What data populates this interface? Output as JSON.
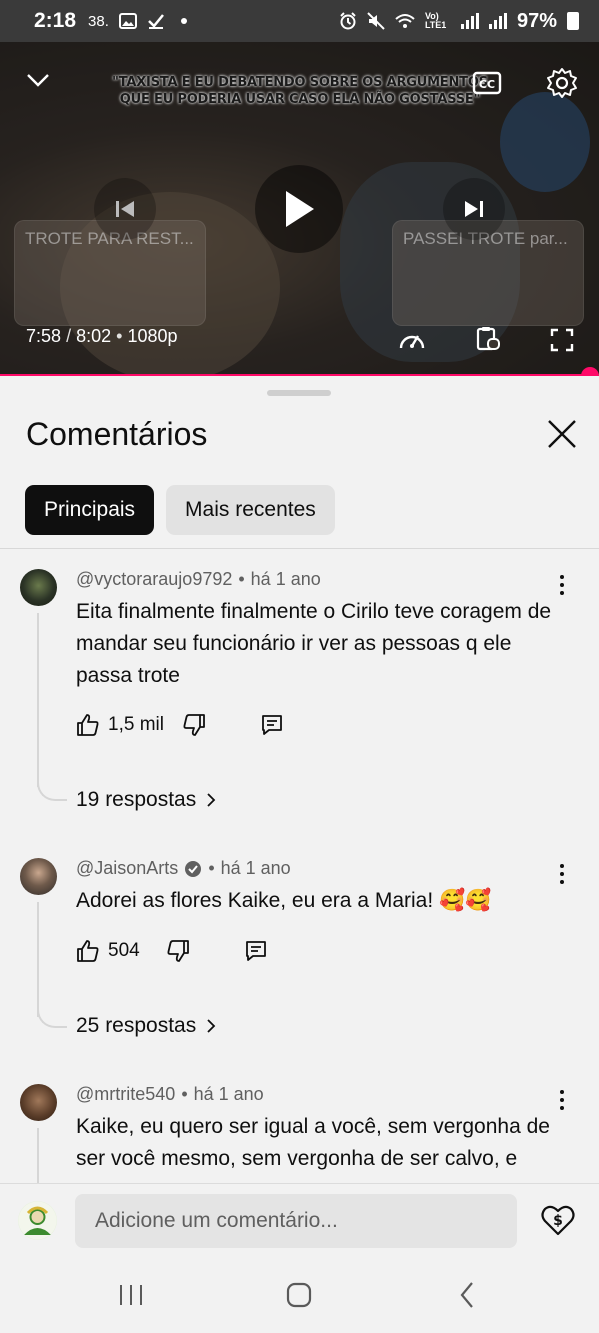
{
  "status_bar": {
    "time": "2:18",
    "notification_count": "38.",
    "network": "Vo) LTE1",
    "battery": "97%"
  },
  "player": {
    "caption": "\"TAXISTA E EU DEBATENDO SOBRE OS ARGUMENTOS QUE EU PODERIA USAR CASO ELA NÃO GOSTASSE\"",
    "prev_video_title": "TROTE PARA REST...",
    "next_video_title": "PASSEI TROTE par...",
    "current_time": "7:58",
    "duration": "8:02",
    "quality": "1080p",
    "progress": 0.992
  },
  "comments_panel": {
    "title": "Comentários",
    "chips": [
      "Principais",
      "Mais recentes"
    ],
    "comments": [
      {
        "author": "@vyctoraraujo9792",
        "age": "há 1 ano",
        "text": "Eita finalmente finalmente o Cirilo teve coragem de mandar seu funcionário ir ver as pessoas q ele passa trote",
        "likes": "1,5 mil",
        "replies": "19 respostas"
      },
      {
        "author": "@JaisonArts",
        "verified": true,
        "age": "há 1 ano",
        "text": "Adorei as flores Kaike, eu era a Maria! 🥰🥰",
        "likes": "504",
        "replies": "25 respostas"
      },
      {
        "author": "@mrtrite540",
        "age": "há 1 ano",
        "text": "Kaike, eu quero ser igual a você, sem vergonha de ser você mesmo, sem vergonha de ser calvo, e"
      }
    ],
    "add_comment_placeholder": "Adicione um comentário..."
  },
  "colors": {
    "accent": "#ff0a68",
    "panel_bg": "#f2f2f2",
    "chip_active": "#0f0f0f"
  }
}
